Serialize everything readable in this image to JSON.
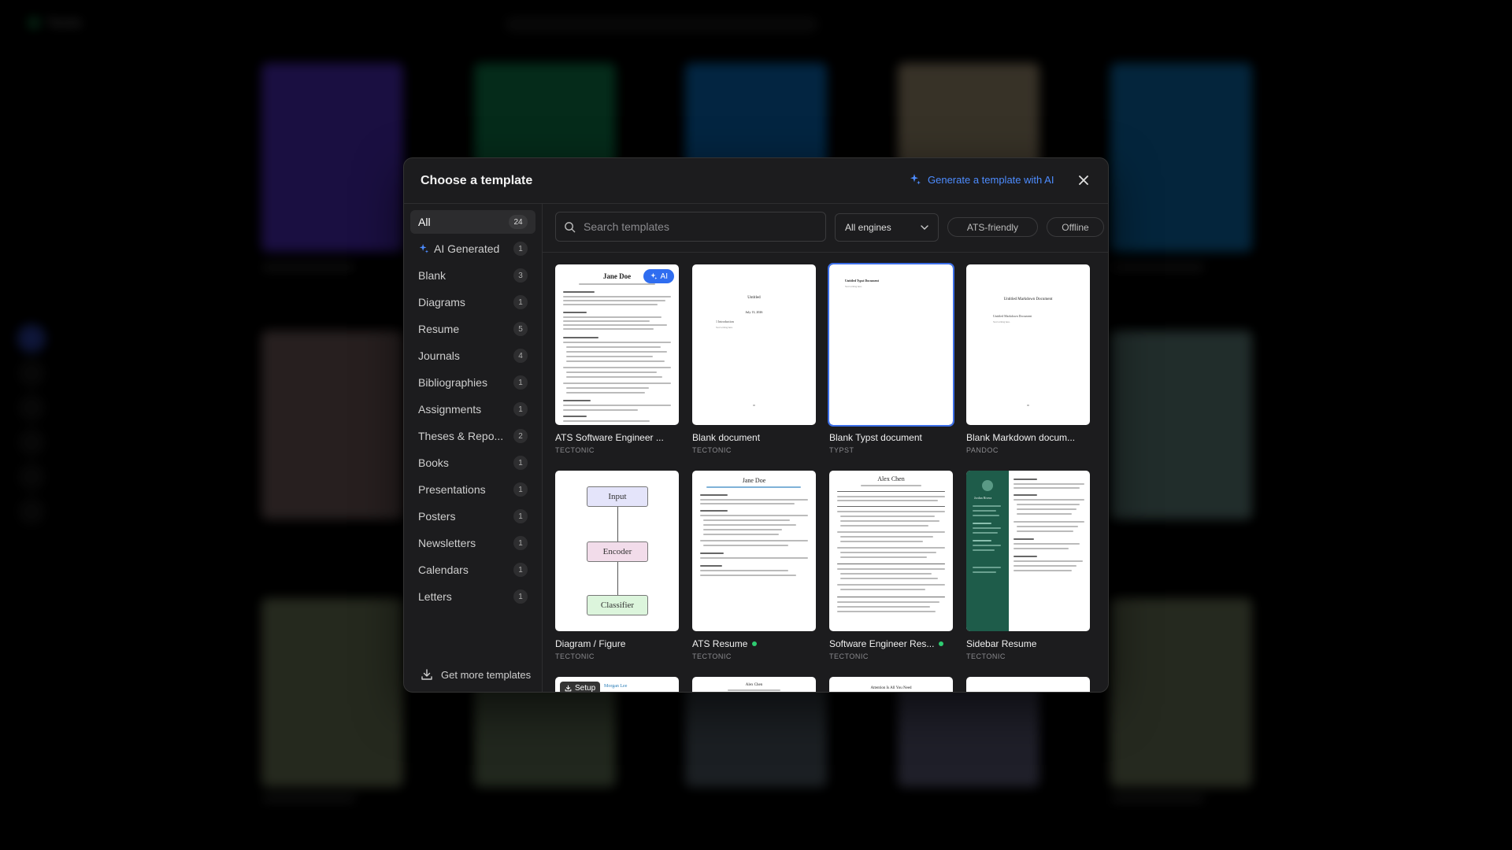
{
  "background": {
    "app_name": "Tectic"
  },
  "modal": {
    "title": "Choose a template",
    "generate_ai_label": "Generate a template with AI"
  },
  "sidebar": {
    "items": [
      {
        "label": "All",
        "count": "24"
      },
      {
        "label": "AI Generated",
        "count": "1"
      },
      {
        "label": "Blank",
        "count": "3"
      },
      {
        "label": "Diagrams",
        "count": "1"
      },
      {
        "label": "Resume",
        "count": "5"
      },
      {
        "label": "Journals",
        "count": "4"
      },
      {
        "label": "Bibliographies",
        "count": "1"
      },
      {
        "label": "Assignments",
        "count": "1"
      },
      {
        "label": "Theses & Repo...",
        "count": "2"
      },
      {
        "label": "Books",
        "count": "1"
      },
      {
        "label": "Presentations",
        "count": "1"
      },
      {
        "label": "Posters",
        "count": "1"
      },
      {
        "label": "Newsletters",
        "count": "1"
      },
      {
        "label": "Calendars",
        "count": "1"
      },
      {
        "label": "Letters",
        "count": "1"
      }
    ],
    "get_more_label": "Get more templates"
  },
  "toolbar": {
    "search_placeholder": "Search templates",
    "engines_label": "All engines",
    "chip_ats": "ATS-friendly",
    "chip_offline": "Offline"
  },
  "templates": [
    {
      "name": "ATS Software Engineer ...",
      "engine": "TECTONIC",
      "badge": "AI",
      "thumb_title": "Jane Doe"
    },
    {
      "name": "Blank document",
      "engine": "TECTONIC",
      "thumb_title": "Untitled",
      "thumb_sub": "July 13, 2026",
      "thumb_section": "1   Introduction",
      "thumb_body": "Start writing here."
    },
    {
      "name": "Blank Typst document",
      "engine": "TYPST",
      "thumb_title": "Untitled Typst Document",
      "thumb_sub": "Start writing here."
    },
    {
      "name": "Blank Markdown docum...",
      "engine": "PANDOC",
      "thumb_title": "Untitled Markdown Document",
      "thumb_section": "Untitled Markdown Document",
      "thumb_body": "Start writing here."
    },
    {
      "name": "Diagram / Figure",
      "engine": "TECTONIC",
      "boxes": [
        "Input",
        "Encoder",
        "Classifier"
      ]
    },
    {
      "name": "ATS Resume",
      "engine": "TECTONIC",
      "thumb_title": "Jane Doe",
      "status": "ready"
    },
    {
      "name": "Software Engineer Res...",
      "engine": "TECTONIC",
      "thumb_title": "Alex Chen",
      "status": "ready"
    },
    {
      "name": "Sidebar Resume",
      "engine": "TECTONIC",
      "thumb_title": "Jordan Rivera"
    },
    {
      "name": "",
      "engine": "",
      "badge": "Setup",
      "thumb_title": "Morgan Lee"
    },
    {
      "name": "",
      "engine": "",
      "thumb_title": "Alex Chen"
    },
    {
      "name": "",
      "engine": "",
      "thumb_title": "Attention Is All You Need"
    },
    {
      "name": "",
      "engine": ""
    }
  ],
  "colors": {
    "accent": "#2f6df0",
    "link": "#4d8cff",
    "status_green": "#2ecc71",
    "sidebar_resume_band": "#1e5c4a"
  }
}
